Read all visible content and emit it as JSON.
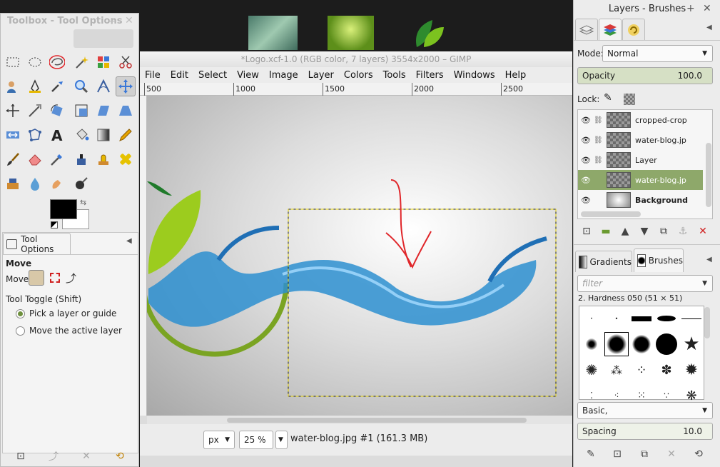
{
  "image_window": {
    "title": "*Logo.xcf-1.0 (RGB color, 7 layers) 3554x2000 – GIMP",
    "menu": [
      "File",
      "Edit",
      "Select",
      "View",
      "Image",
      "Layer",
      "Colors",
      "Tools",
      "Filters",
      "Windows",
      "Help"
    ],
    "ruler_ticks": [
      "500",
      "1000",
      "1500",
      "2000",
      "2500"
    ],
    "unit": "px",
    "zoom": "25 %",
    "status": "water-blog.jpg #1 (161.3 MB)"
  },
  "toolbox": {
    "title": "Toolbox - Tool Options",
    "fg_color": "#000000",
    "bg_color": "#ffffff",
    "tool_options": {
      "tab_label": "Tool Options",
      "heading": "Move",
      "move_label": "Move:",
      "toggle_label": "Tool Toggle  (Shift)",
      "option_pick": "Pick a layer or guide",
      "option_active": "Move the active layer"
    }
  },
  "dock": {
    "title": "Layers - Brushes",
    "mode_label": "Mode:",
    "mode_value": "Normal",
    "opacity_label": "Opacity",
    "opacity_value": "100.0",
    "lock_label": "Lock:",
    "layers": [
      {
        "name": "cropped-crop"
      },
      {
        "name": "water-blog.jp"
      },
      {
        "name": "Layer"
      },
      {
        "name": "water-blog.jp",
        "selected": true
      },
      {
        "name": "Background",
        "bold": true
      }
    ],
    "tabs": [
      "Gradients",
      "Brushes"
    ],
    "filter_placeholder": "filter",
    "brush_name": "2. Hardness 050 (51 × 51)",
    "preset": "Basic,",
    "spacing_label": "Spacing",
    "spacing_value": "10.0"
  },
  "colors": {
    "accent_green": "#8ea86a",
    "annotation_red": "#e0262a"
  }
}
